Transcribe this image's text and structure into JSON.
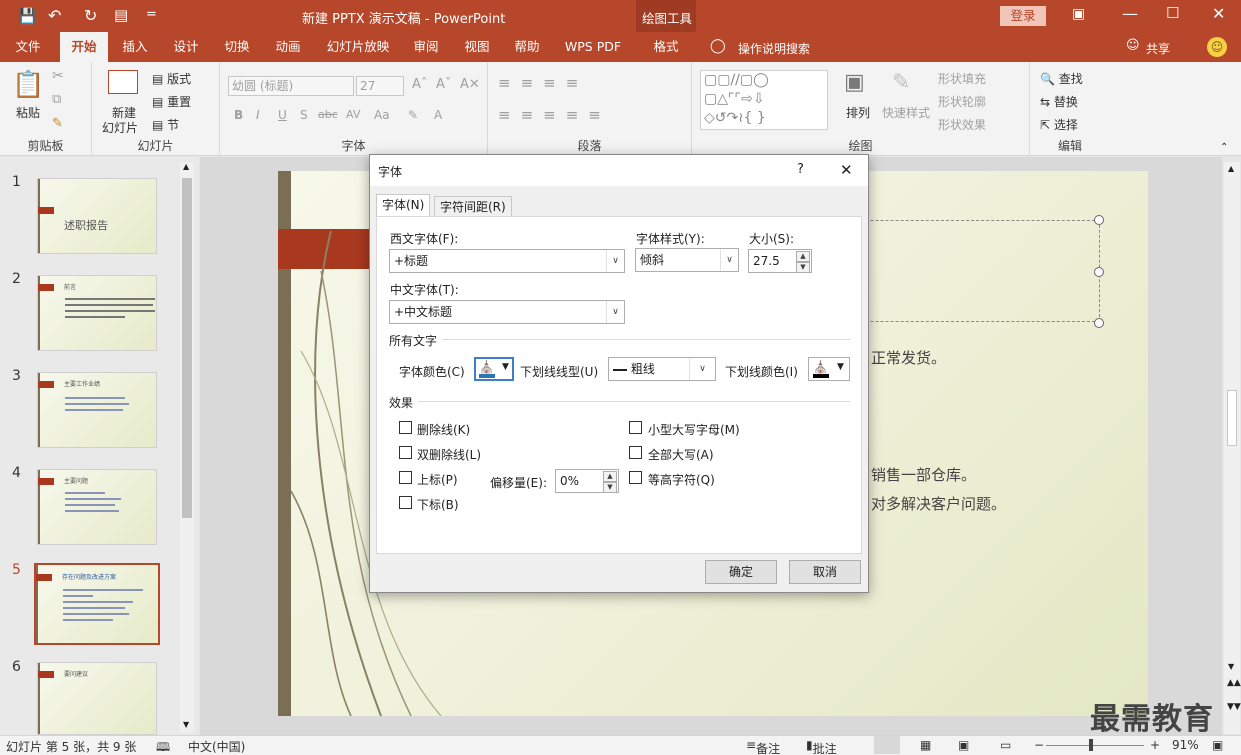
{
  "app": {
    "title": "新建 PPTX 演示文稿 - PowerPoint",
    "drawing_tools": "绘图工具",
    "login": "登录",
    "share": "共享",
    "qat_more": "="
  },
  "ribbon_tabs": [
    "文件",
    "开始",
    "插入",
    "设计",
    "切换",
    "动画",
    "幻灯片放映",
    "审阅",
    "视图",
    "帮助",
    "WPS PDF",
    "格式"
  ],
  "tell_me": "操作说明搜索",
  "ribbon": {
    "clipboard": {
      "paste": "粘贴",
      "label": "剪贴板"
    },
    "slides": {
      "new_slide": "新建",
      "new_slide2": "幻灯片",
      "layout": "版式",
      "reset": "重置",
      "section": "节",
      "label": "幻灯片"
    },
    "font": {
      "font_name": "幼圆 (标题)",
      "font_size": "27",
      "label": "字体",
      "bold": "B",
      "italic": "I",
      "underline": "U",
      "shadow": "S",
      "strike": "abc",
      "spacing": "AV",
      "case": "Aa",
      "color": "A"
    },
    "paragraph": {
      "label": "段落"
    },
    "drawing": {
      "arrange": "排列",
      "quick_styles": "快速样式",
      "fill": "形状填充",
      "outline": "形状轮廓",
      "effects": "形状效果",
      "label": "绘图"
    },
    "editing": {
      "find": "查找",
      "replace": "替换",
      "select": "选择",
      "label": "编辑"
    }
  },
  "slides": [
    {
      "num": "1",
      "title": "述职报告"
    },
    {
      "num": "2",
      "title": "前言"
    },
    {
      "num": "3",
      "title": "主要工作业绩"
    },
    {
      "num": "4",
      "title": "主要问题"
    },
    {
      "num": "5",
      "title": "存在问题及改进方案",
      "active": true
    },
    {
      "num": "6",
      "title": "要问建议"
    }
  ],
  "slide_content": {
    "line1": "正常发货。",
    "line2": "销售一部仓库。",
    "line3": "对多解决客户问题。"
  },
  "dialog": {
    "title": "字体",
    "help": "?",
    "close": "✕",
    "tab_font": "字体(N)",
    "tab_spacing": "字符间距(R)",
    "latin_font_label": "西文字体(F):",
    "latin_font_value": "+标题",
    "style_label": "字体样式(Y):",
    "style_value": "倾斜",
    "size_label": "大小(S):",
    "size_value": "27.5",
    "asian_font_label": "中文字体(T):",
    "asian_font_value": "+中文标题",
    "all_text": "所有文字",
    "font_color_label": "字体颜色(C)",
    "underline_style_label": "下划线线型(U)",
    "underline_style_value": "粗线",
    "underline_color_label": "下划线颜色(I)",
    "effects": "效果",
    "strikethrough": "删除线(K)",
    "double_strikethrough": "双删除线(L)",
    "superscript": "上标(P)",
    "subscript": "下标(B)",
    "offset_label": "偏移量(E):",
    "offset_value": "0%",
    "small_caps": "小型大写字母(M)",
    "all_caps": "全部大写(A)",
    "equalize": "等高字符(Q)",
    "ok": "确定",
    "cancel": "取消"
  },
  "status": {
    "slide_info": "幻灯片 第 5 张，共 9 张",
    "language": "中文(中国)",
    "notes": "备注",
    "comments": "批注",
    "zoom": "91%"
  },
  "watermark": "最需教育",
  "colors": {
    "accent": "#b7472a",
    "slide_bar": "#7a6e54"
  }
}
